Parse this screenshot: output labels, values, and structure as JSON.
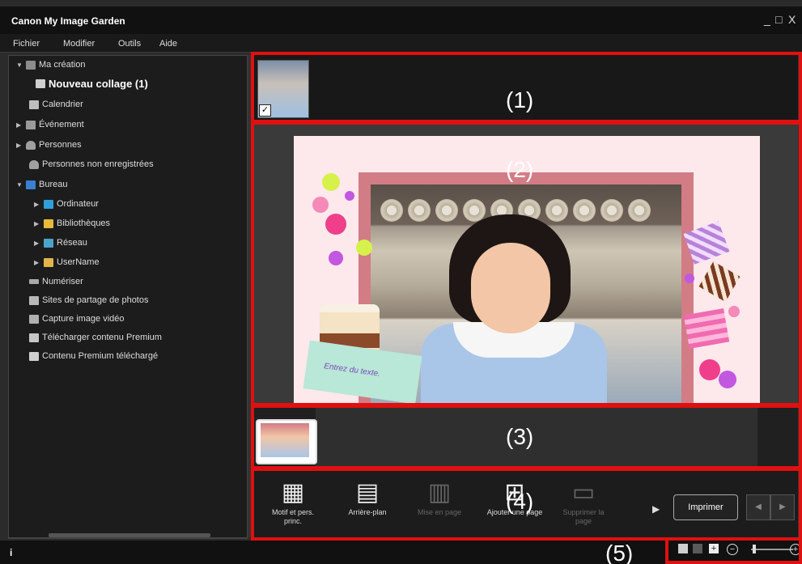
{
  "window": {
    "title": "Canon My Image Garden",
    "controls": [
      "_",
      "□",
      "X"
    ]
  },
  "menu": [
    "Fichier",
    "Modifier",
    "Outils",
    "Aide"
  ],
  "sidebar": {
    "items": [
      {
        "label": "Ma création",
        "icon": "creation-icon",
        "arrow": "▼"
      },
      {
        "label": "Nouveau collage (1)",
        "icon": "collage-icon",
        "arrow": ""
      },
      {
        "label": "Calendrier",
        "icon": "calendar-icon",
        "arrow": ""
      },
      {
        "label": "Événement",
        "icon": "event-icon",
        "arrow": "▶"
      },
      {
        "label": "Personnes",
        "icon": "person-icon",
        "arrow": "▶"
      },
      {
        "label": "Personnes non enregistrées",
        "icon": "person-icon",
        "arrow": ""
      },
      {
        "label": "Bureau",
        "icon": "desktop-icon",
        "arrow": "▼"
      },
      {
        "label": "Ordinateur",
        "icon": "computer-icon",
        "arrow": "▶"
      },
      {
        "label": "Bibliothèques",
        "icon": "libraries-icon",
        "arrow": "▶"
      },
      {
        "label": "Réseau",
        "icon": "network-icon",
        "arrow": "▶"
      },
      {
        "label": "UserName",
        "icon": "user-folder-icon",
        "arrow": "▶"
      },
      {
        "label": "Numériser",
        "icon": "scan-icon",
        "arrow": ""
      },
      {
        "label": "Sites de partage de photos",
        "icon": "share-icon",
        "arrow": ""
      },
      {
        "label": "Capture image vidéo",
        "icon": "video-icon",
        "arrow": ""
      },
      {
        "label": "Télécharger contenu Premium",
        "icon": "download-icon",
        "arrow": ""
      },
      {
        "label": "Contenu Premium téléchargé",
        "icon": "folder-icon",
        "arrow": ""
      }
    ]
  },
  "collage": {
    "text_placeholder": "Entrez du texte."
  },
  "toolbar": {
    "tools": [
      {
        "label": "Motif et pers. princ.",
        "icon": "layout-person-icon",
        "enabled": true
      },
      {
        "label": "Arrière-plan",
        "icon": "background-icon",
        "enabled": true
      },
      {
        "label": "Mise en page",
        "icon": "page-layout-icon",
        "enabled": false
      },
      {
        "label": "Ajouter une page",
        "icon": "add-page-icon",
        "enabled": true
      },
      {
        "label": "Supprimer la page",
        "icon": "delete-page-icon",
        "enabled": false
      }
    ],
    "print_label": "Imprimer"
  },
  "statusbar": {
    "info_icon": "i"
  },
  "callouts": [
    "(1)",
    "(2)",
    "(3)",
    "(4)",
    "(5)"
  ],
  "colors": {
    "callout_border": "#e01010",
    "window_bg": "#2b2b2b"
  }
}
